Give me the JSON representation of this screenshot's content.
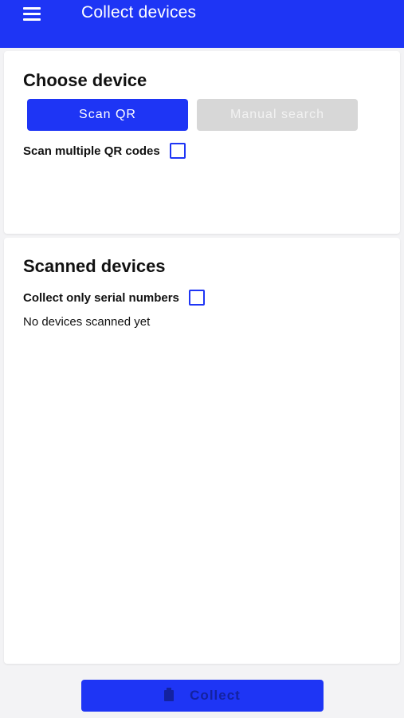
{
  "header": {
    "title": "Collect devices",
    "menu_icon": "menu-icon"
  },
  "choose_device": {
    "title": "Choose device",
    "scan_qr_label": "Scan QR",
    "manual_search_label": "Manual search",
    "scan_multiple_label": "Scan multiple QR codes",
    "scan_multiple_checked": false
  },
  "scanned_devices": {
    "title": "Scanned devices",
    "serial_only_label": "Collect only serial numbers",
    "serial_only_checked": false,
    "empty_text": "No devices scanned yet"
  },
  "footer": {
    "collect_label": "Collect",
    "collect_icon": "clipboard-icon"
  },
  "colors": {
    "primary": "#1e35f5",
    "disabled": "#d7d7d7"
  }
}
